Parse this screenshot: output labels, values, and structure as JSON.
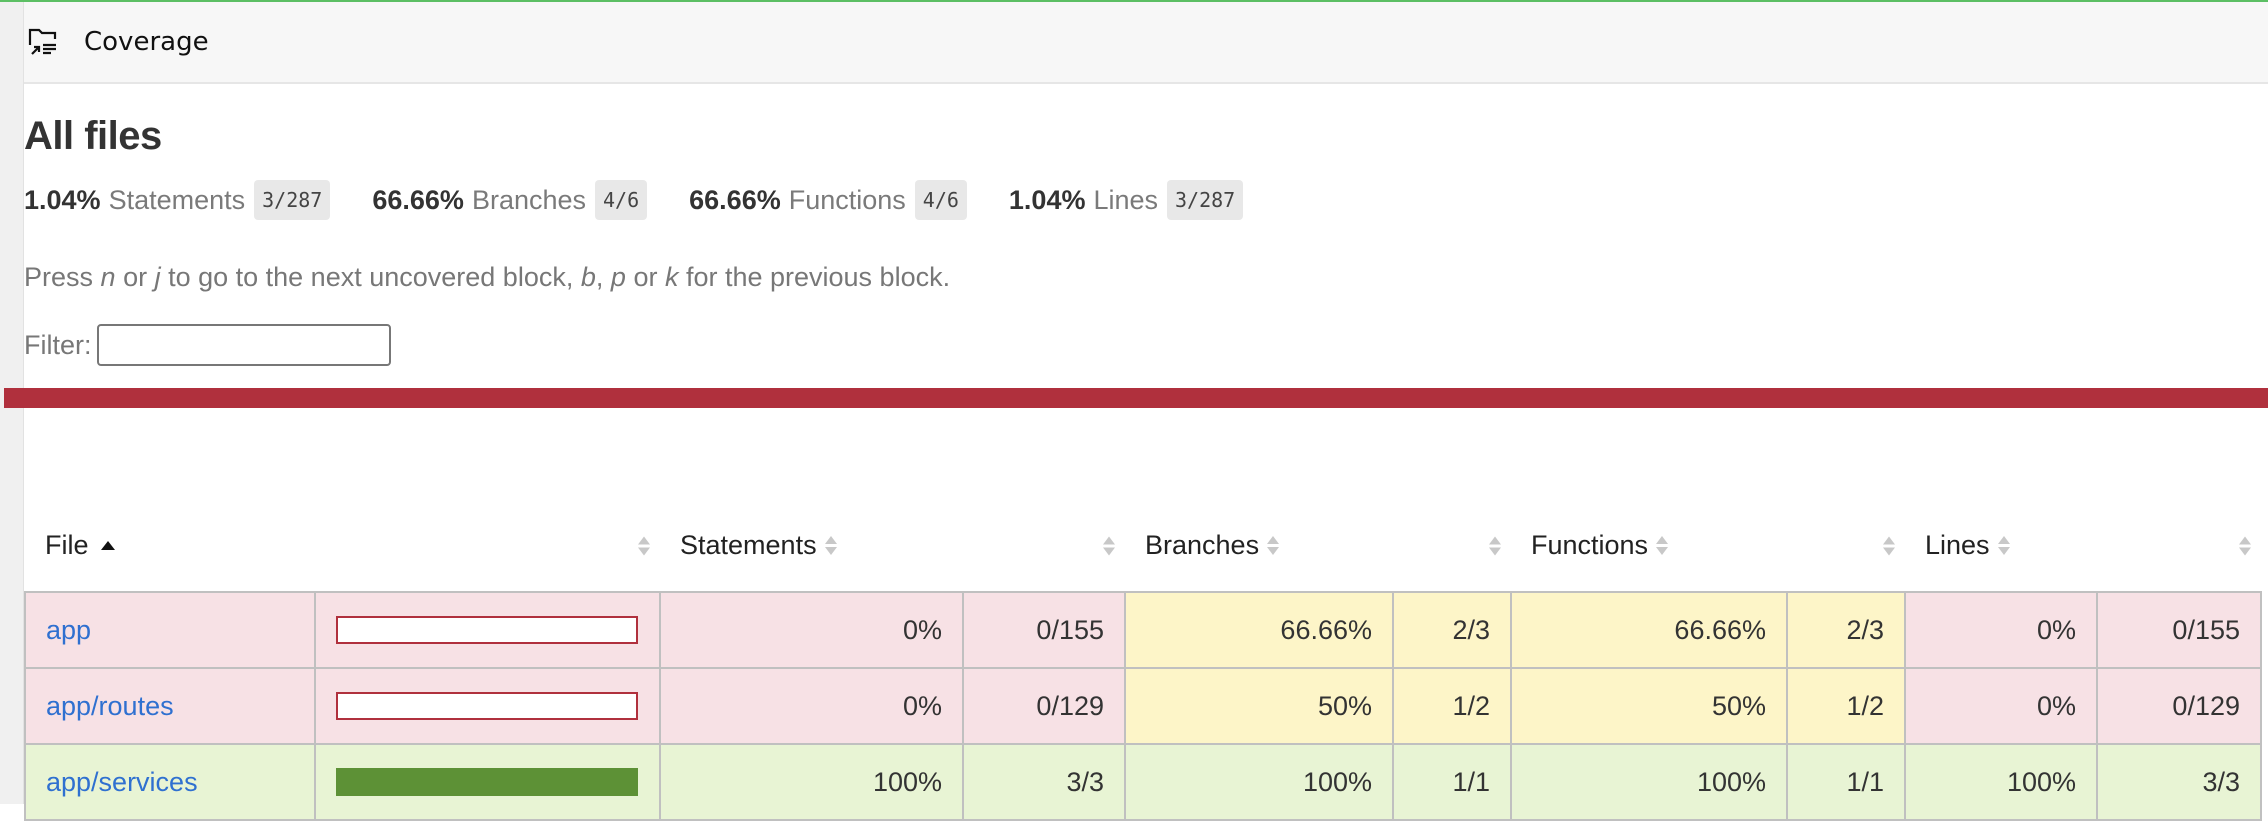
{
  "header": {
    "title": "Coverage",
    "icon": "coverage-folder-icon"
  },
  "page": {
    "title": "All files",
    "summary": [
      {
        "pct": "1.04%",
        "label": "Statements",
        "fraction": "3/287"
      },
      {
        "pct": "66.66%",
        "label": "Branches",
        "fraction": "4/6"
      },
      {
        "pct": "66.66%",
        "label": "Functions",
        "fraction": "4/6"
      },
      {
        "pct": "1.04%",
        "label": "Lines",
        "fraction": "3/287"
      }
    ],
    "hint": {
      "p1": "Press ",
      "k1": "n",
      "p2": " or ",
      "k2": "j",
      "p3": " to go to the next uncovered block, ",
      "k3": "b",
      "p4": ", ",
      "k4": "p",
      "p5": " or ",
      "k5": "k",
      "p6": " for the previous block."
    },
    "filter": {
      "label": "Filter:",
      "value": ""
    },
    "status_color": "#b0303d"
  },
  "table": {
    "headers": {
      "file": "File",
      "statements": "Statements",
      "branches": "Branches",
      "functions": "Functions",
      "lines": "Lines"
    },
    "sort": {
      "column": "File",
      "direction": "ascending"
    },
    "rows": [
      {
        "file": "app",
        "coverage_fraction": 0,
        "level": "low",
        "statements": {
          "pct": "0%",
          "frac": "0/155",
          "level": "low"
        },
        "branches": {
          "pct": "66.66%",
          "frac": "2/3",
          "level": "medium"
        },
        "functions": {
          "pct": "66.66%",
          "frac": "2/3",
          "level": "medium"
        },
        "lines": {
          "pct": "0%",
          "frac": "0/155",
          "level": "low"
        }
      },
      {
        "file": "app/routes",
        "coverage_fraction": 0,
        "level": "low",
        "statements": {
          "pct": "0%",
          "frac": "0/129",
          "level": "low"
        },
        "branches": {
          "pct": "50%",
          "frac": "1/2",
          "level": "medium"
        },
        "functions": {
          "pct": "50%",
          "frac": "1/2",
          "level": "medium"
        },
        "lines": {
          "pct": "0%",
          "frac": "0/129",
          "level": "low"
        }
      },
      {
        "file": "app/services",
        "coverage_fraction": 1,
        "level": "high",
        "statements": {
          "pct": "100%",
          "frac": "3/3",
          "level": "high"
        },
        "branches": {
          "pct": "100%",
          "frac": "1/1",
          "level": "high"
        },
        "functions": {
          "pct": "100%",
          "frac": "1/1",
          "level": "high"
        },
        "lines": {
          "pct": "100%",
          "frac": "3/3",
          "level": "high"
        }
      }
    ]
  },
  "colors": {
    "low_bg": "#f7e1e5",
    "medium_bg": "#fdf5c8",
    "high_bg": "#e8f4d4",
    "bar_low_border": "#b0303d",
    "bar_high_fill": "#5d9136",
    "link": "#2f70d0",
    "top_accent": "#5cbf64"
  }
}
